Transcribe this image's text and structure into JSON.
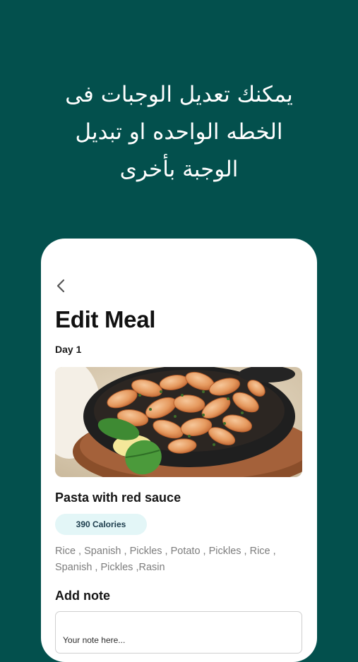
{
  "headline": {
    "line1": "يمكنك تعديل الوجبات فى",
    "line2": "الخطه الواحده او تبديل",
    "line3": "الوجبة بأخرى"
  },
  "screen": {
    "title": "Edit Meal",
    "day": "Day 1",
    "meal": {
      "name": "Pasta with red sauce",
      "calories": "390 Calories",
      "ingredients_line1": "Rice , Spanish , Pickles , Potato , Pickles , Rice ,",
      "ingredients_line2": "Spanish , Pickles ,Rasin"
    },
    "note": {
      "label": "Add note",
      "placeholder": "Your note here..."
    }
  },
  "colors": {
    "background": "#03504d",
    "card": "#ffffff",
    "calories_pill": "#e3f6f7"
  },
  "icons": {
    "back": "chevron-left-icon"
  }
}
